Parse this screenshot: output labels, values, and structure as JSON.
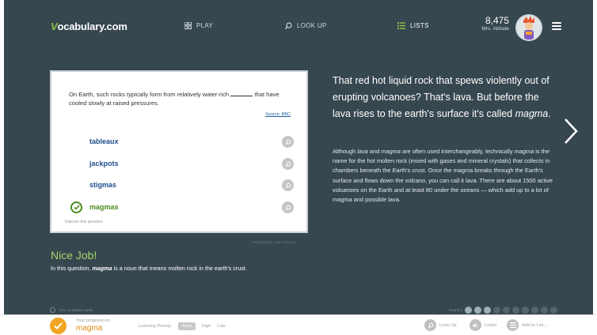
{
  "header": {
    "logo_mark": "V",
    "logo_text": "ocabulary.com",
    "nav": {
      "play": "PLAY",
      "lookup": "LOOK UP",
      "lists": "LISTS"
    },
    "points": "8,475",
    "user_name": "Mrs. Abbate",
    "icons": {
      "play": "grid-icon",
      "lookup": "search-icon",
      "lists": "list-icon",
      "menu": "hamburger-menu-icon"
    }
  },
  "question": {
    "prompt_before": "On Earth, such rocks typically form from relatively water-rich",
    "prompt_after": "that have cooled slowly at raised pressures.",
    "source": "Source: BBC",
    "choices": [
      {
        "label": "tableaux",
        "state": "neutral"
      },
      {
        "label": "jackpots",
        "state": "neutral"
      },
      {
        "label": "stigmas",
        "state": "neutral"
      },
      {
        "label": "magmas",
        "state": "correct"
      }
    ],
    "improve_link": "Improve this question",
    "progress_meta": "PROGRESS: 100 POINTS"
  },
  "feedback": {
    "title": "Nice Job!",
    "text_pre": "In this question, ",
    "word": "magma",
    "text_post": " is a noun that means molten rock in the earth's crust."
  },
  "explanation": {
    "headline_1": "That red hot liquid rock that spews violently out of erupting volcanoes? That's lava. But before the lava rises to the earth's surface it's called ",
    "headline_word": "magma",
    "headline_2": ".",
    "body_1": "Although ",
    "body_lava": "lava",
    "body_2": " and ",
    "body_magma_1": "magma",
    "body_3": " are often used interchangeably, technically ",
    "body_magma_2": "magma",
    "body_4": " is the name for the hot molten rock (mixed with gases and mineral crystals) that collects in chambers beneath the Earth's crust. Once the magma breaks through the Earth's surface and flows down the volcano, you can call it lava. There are about 1500 active volcanoes on the Earth and at least 80 under the oceans — which add up to a lot of magma and possible lava."
  },
  "footer_strip": {
    "audio_label": "Turn on spoken audio",
    "round_label": "Round 1"
  },
  "bottom_bar": {
    "progress_label": "Your progress on:",
    "progress_word": "magma",
    "priority_label": "Learning Priority:",
    "priority_options": [
      "Auto",
      "High",
      "Low"
    ],
    "priority_selected": "Auto",
    "actions": {
      "lookup": "Look Up",
      "listen": "Listen",
      "add_list": "Add to List..."
    }
  },
  "colors": {
    "stage_bg": "#37474f",
    "accent_green": "#a5d66b",
    "choice_blue": "#1f4e8c",
    "correct_green": "#4e8a1e",
    "badge_orange": "#f0a521"
  }
}
